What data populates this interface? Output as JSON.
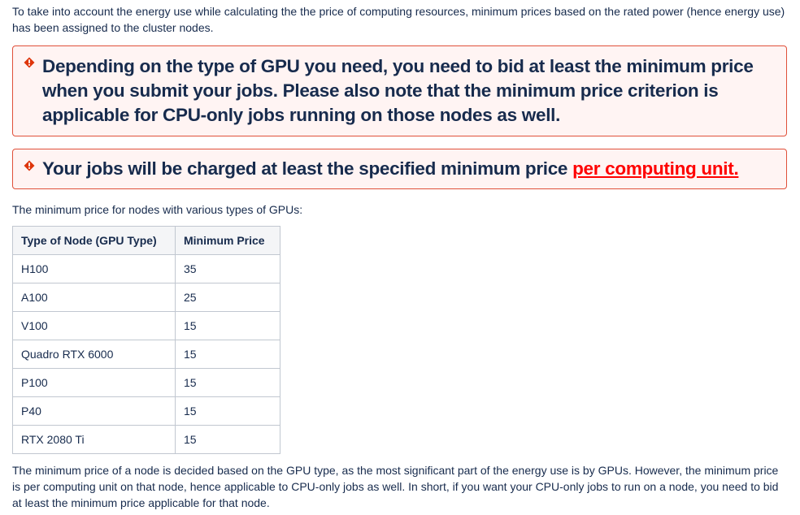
{
  "intro": "To take into account the energy use while calculating the the price of computing resources, minimum prices based on the rated power (hence energy use) has been assigned to the cluster nodes.",
  "alerts": {
    "first": "Depending on the type of GPU you need, you need to bid at least the minimum price when you submit your jobs. Please also note that the minimum price criterion is applicable for CPU-only jobs running on those nodes as well.",
    "second_text": "Your jobs will be charged at least the specified minimum price ",
    "second_link": "per computing unit."
  },
  "table_intro": "The minimum price for nodes with various types of GPUs:",
  "table": {
    "headers": [
      "Type of Node (GPU Type)",
      "Minimum Price"
    ],
    "rows": [
      [
        "H100",
        "35"
      ],
      [
        "A100",
        "25"
      ],
      [
        "V100",
        "15"
      ],
      [
        "Quadro RTX 6000",
        "15"
      ],
      [
        "P100",
        "15"
      ],
      [
        "P40",
        "15"
      ],
      [
        "RTX 2080 Ti",
        "15"
      ]
    ]
  },
  "outro": "The minimum price of a node is decided based on the GPU type, as the most significant part of the energy use is by GPUs. However, the minimum price is per computing unit on that node, hence applicable to CPU-only jobs as well. In short, if you want your CPU-only jobs to run on a node, you need to bid at least the minimum price applicable for that node.",
  "colors": {
    "error": "#de350b",
    "text": "#172b4d",
    "link": "#ff0000"
  }
}
